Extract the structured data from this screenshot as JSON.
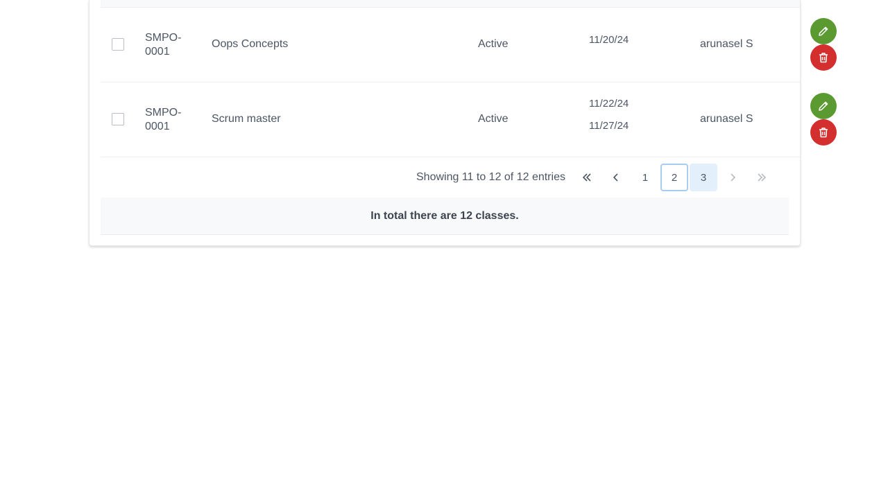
{
  "rows": [
    {
      "code": "SMPO-0001",
      "name": "Oops Concepts",
      "status": "Active",
      "dates": [
        "11/20/24"
      ],
      "user": "arunasel S"
    },
    {
      "code": "SMPO-0001",
      "name": "Scrum master",
      "status": "Active",
      "dates": [
        "11/22/24",
        "11/27/24"
      ],
      "user": "arunasel S"
    }
  ],
  "pagination": {
    "summary": "Showing 11 to 12 of 12 entries",
    "pages": [
      "1",
      "2",
      "3"
    ],
    "current_page": "2"
  },
  "footer": {
    "text": "In total there are 12 classes."
  },
  "colors": {
    "edit": "#5a9a31",
    "delete": "#d32f2f",
    "current_page_border": "#a7cdf2",
    "page_highlight": "#e3f0fb"
  },
  "icons": {
    "edit": "pencil-icon",
    "delete": "trash-icon",
    "first": "double-chevron-left-icon",
    "prev": "chevron-left-icon",
    "next": "chevron-right-icon",
    "last": "double-chevron-right-icon"
  }
}
